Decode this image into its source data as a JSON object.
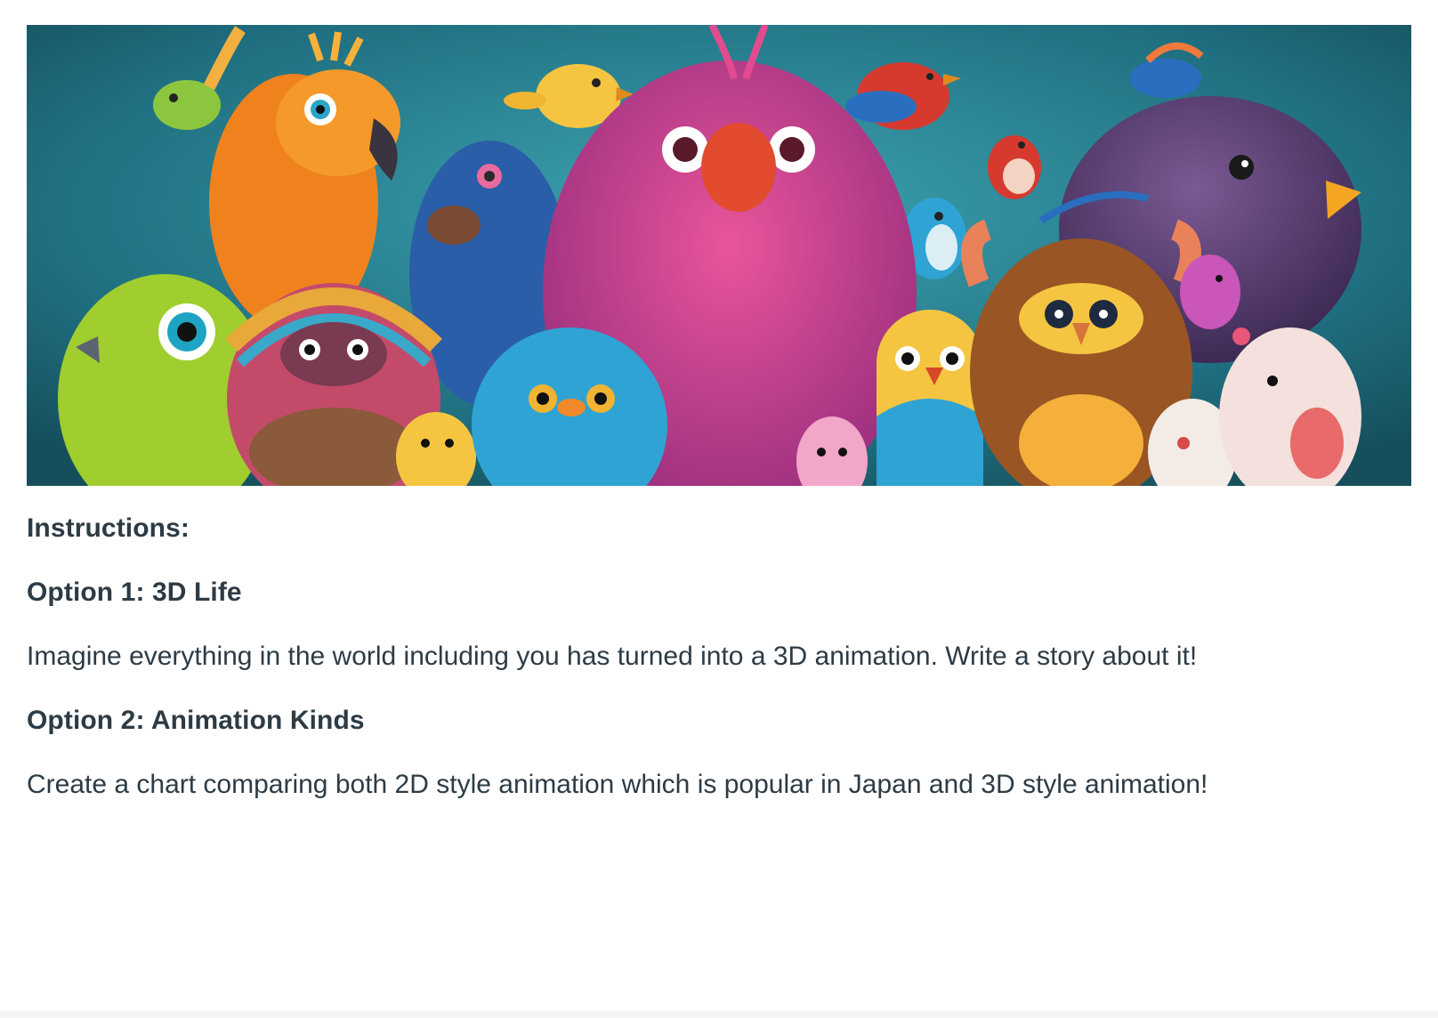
{
  "banner": {
    "alt": "colorful cartoon birds illustration",
    "colors": {
      "background": "#2a7f8f",
      "pink_bird": "#d6438a",
      "orange_bird": "#f0821e",
      "green_bird": "#8cc63f",
      "blue_bird": "#2a5ea8",
      "purple_bird": "#5e3f78",
      "yellow_bird": "#f5c542",
      "red_bird": "#d63a2f",
      "brown_bird": "#9a5524",
      "cyan_bird": "#2fa3d4"
    }
  },
  "instructions": {
    "title": "Instructions:",
    "option1_title": "Option 1: 3D Life",
    "option1_text": "Imagine everything in the world including you has turned into a 3D animation. Write a story about it!",
    "option2_title": "Option 2: Animation Kinds",
    "option2_text": "Create a chart comparing both 2D style animation which is popular in Japan and 3D style animation!"
  }
}
